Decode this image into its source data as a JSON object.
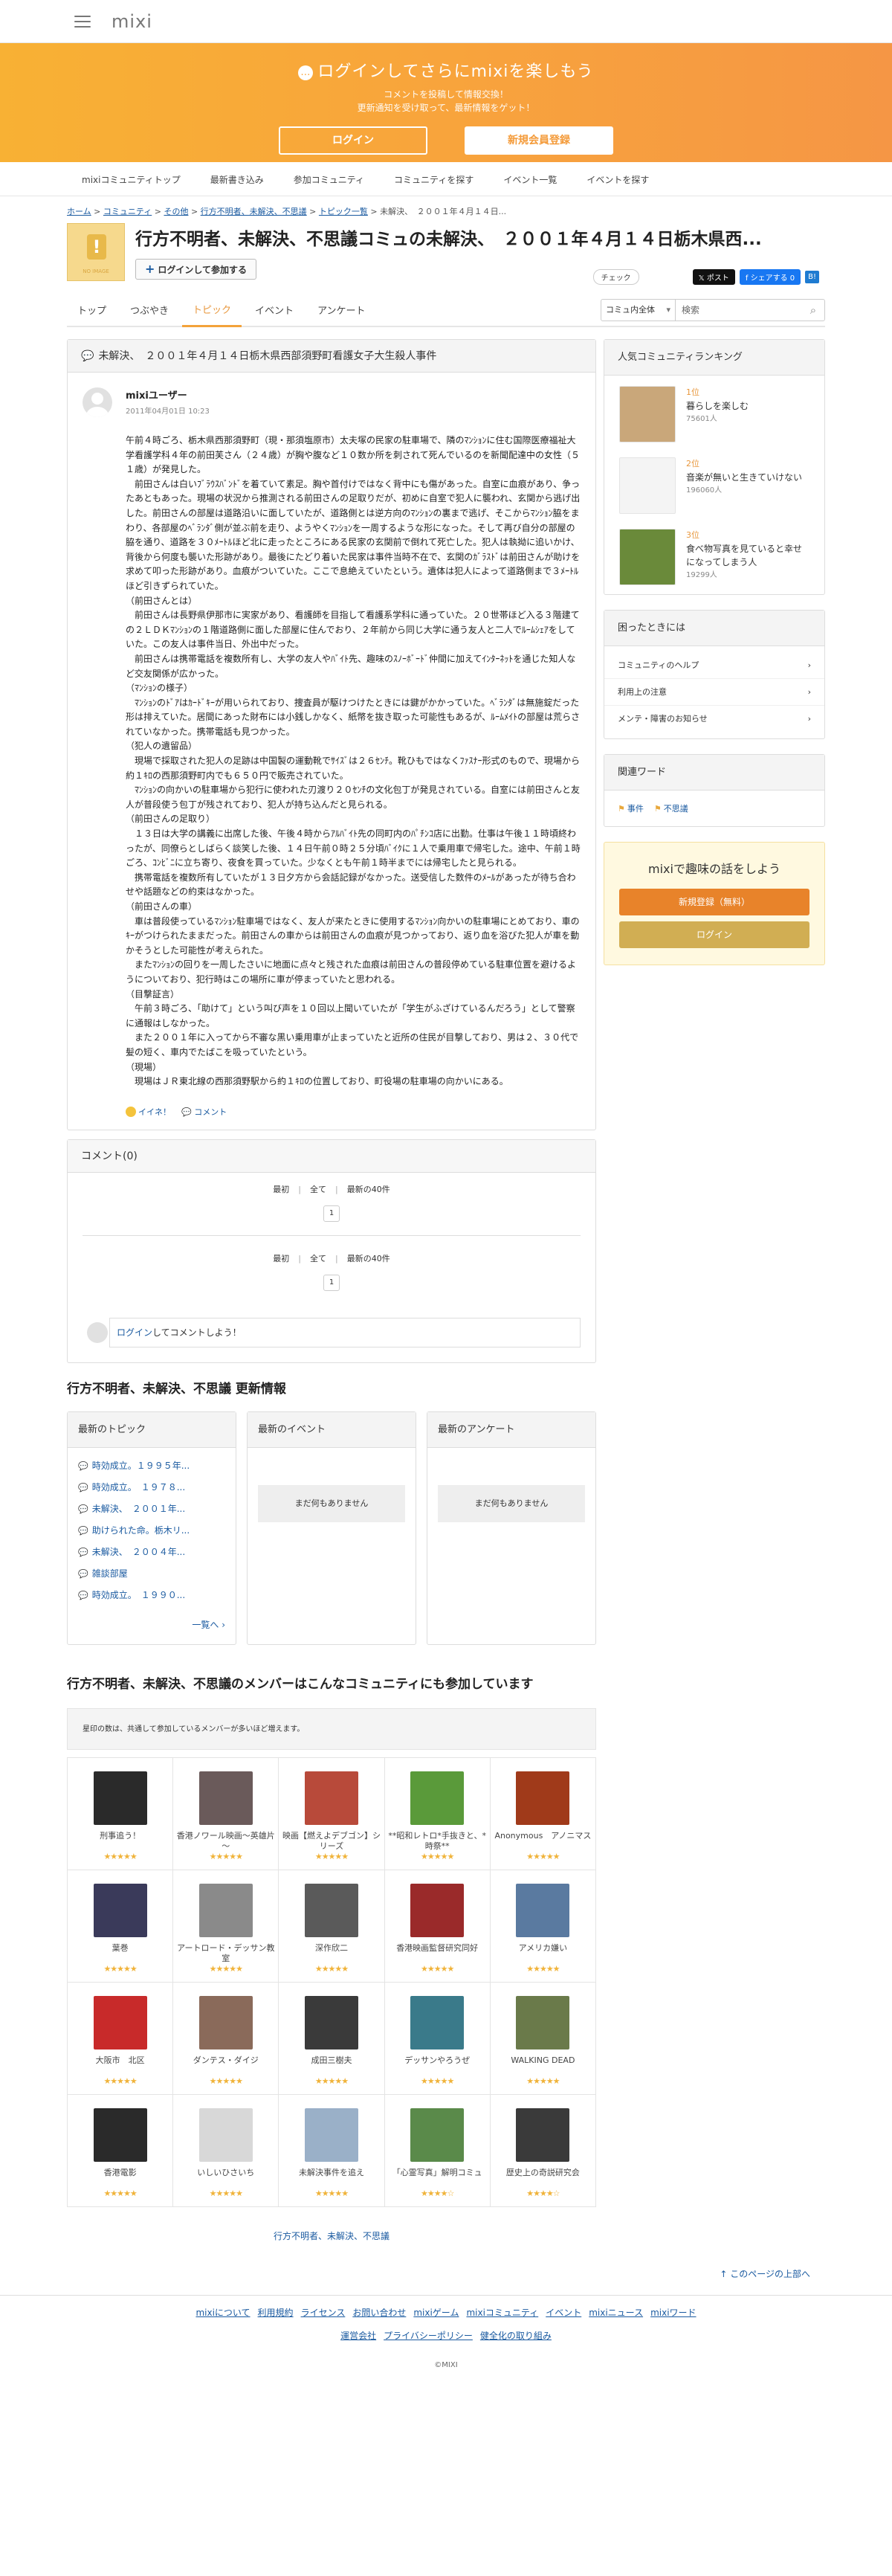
{
  "header": {
    "logo": "mixi"
  },
  "banner": {
    "title": "ログインしてさらにmixiを楽しもう",
    "sub1": "コメントを投稿して情報交換！",
    "sub2": "更新通知を受け取って、最新情報をゲット！",
    "login_label": "ログイン",
    "register_label": "新規会員登録"
  },
  "gnav": [
    "mixiコミュニティトップ",
    "最新書き込み",
    "参加コミュニティ",
    "コミュニティを探す",
    "イベント一覧",
    "イベントを探す"
  ],
  "breadcrumb": {
    "items": [
      "ホーム",
      "コミュニティ",
      "その他",
      "行方不明者、未解決、不思議",
      "トピック一覧"
    ],
    "current": "未解決、　２００１年４月１４日..."
  },
  "community": {
    "thumb_text": "NO IMAGE",
    "title": "行方不明者、未解決、不思議コミュの未解決、　２００１年４月１４日栃木県西...",
    "join_label": "ログインして参加する"
  },
  "share": {
    "check": "チェック",
    "post": "ポスト",
    "fb": "シェアする 0",
    "bm": "B!"
  },
  "tabs": [
    "トップ",
    "つぶやき",
    "トピック",
    "イベント",
    "アンケート"
  ],
  "search": {
    "scope": "コミュ内全体",
    "placeholder": "検索"
  },
  "topic": {
    "header": "未解決、　２００１年４月１４日栃木県西部須野町看護女子大生殺人事件",
    "user": "mixiユーザー",
    "date": "2011年04月01日 10:23",
    "body": "午前４時ごろ、栃木県西那須野町（現・那須塩原市）太夫塚の民家の駐車場で、隣のﾏﾝｼｮﾝに住む国際医療福祉大学看護学科４年の前田芙さん（２４歳）が胸や腹など１０数か所を刺されて死んでいるのを新聞配達中の女性（５１歳）が発見した。\n　前田さんは白いﾌﾞﾗｳｽﾊﾞﾝﾄﾞを着ていて素足。胸や首付けではなく背中にも傷があった。自室に血痕があり、争ったあともあった。現場の状況から推測される前田さんの足取りだが、初めに自室で犯人に襲われ、玄関から逃げ出した。前田さんの部屋は道路沿いに面していたが、道路側とは逆方向のﾏﾝｼｮﾝの裏まで逃げ、そこからﾏﾝｼｮﾝ脇をまわり、各部屋のﾍﾞﾗﾝﾀﾞ側が並ぶ前を走り、ようやくﾏﾝｼｮﾝを一周するような形になった。そして再び自分の部屋の脇を通り、道路を３０ﾒｰﾄﾙほど北に走ったところにある民家の玄関前で倒れて死亡した。犯人は執拗に追いかけ、背後から何度も襲いた形跡があり。最後にたどり着いた民家は事件当時不在で、玄関のｶﾞﾗｽﾄﾞは前田さんが助けを求めて叩った形跡があり。血痕がついていた。ここで息絶えていたという。遺体は犯人によって道路側まで３ﾒｰﾄﾙほど引きずられていた。\n（前田さんとは）\n　前田さんは長野県伊那市に実家があり、看護師を目指して看護系学科に通っていた。２０世帯ほど入る３階建ての２ＬＤＫﾏﾝｼｮﾝの１階道路側に面した部屋に住んでおり、２年前から同じ大学に通う友人と二人でﾙｰﾑｼｪｱをしていた。この友人は事件当日、外出中だった。\n　前田さんは携帯電話を複数所有し、大学の友人やﾊﾞｲﾄ先、趣味のｽﾉｰﾎﾞｰﾄﾞ仲間に加えてｲﾝﾀｰﾈｯﾄを通じた知人など交友関係が広かった。\n（ﾏﾝｼｮﾝの様子）\n　ﾏﾝｼｮﾝのﾄﾞｱはｶｰﾄﾞｷｰが用いられており、捜査員が駆けつけたときには鍵がかかっていた。ﾍﾞﾗﾝﾀﾞは無施錠だった形は排えていた。居間にあった財布には小銭しかなく、紙幣を抜き取った可能性もあるが、ﾙｰﾑﾒｲﾄの部屋は荒らされていなかった。携帯電話も見つかった。\n（犯人の遺留品）\n　現場で採取された犯人の足跡は中国製の運動靴でｻｲｽﾞは２６ｾﾝﾁ。靴ひもではなくﾌｧｽﾅｰ形式のもので、現場から約１ｷﾛの西那須野町内でも６５０円で販売されていた。\n　ﾏﾝｼｮﾝの向かいの駐車場から犯行に使われた刃渡り２０ｾﾝﾁの文化包丁が発見されている。自室には前田さんと友人が普段使う包丁が残されており、犯人が持ち込んだと見られる。\n（前田さんの足取り）\n　１３日は大学の講義に出席した後、午後４時からｱﾙﾊﾞｲﾄ先の同町内のﾊﾟﾁﾝｺ店に出勤。仕事は午後１１時頃終わったが、同僚らとしばらく談笑した後、１４日午前０時２５分頃ﾊﾞｲｸに１人で乗用車で帰宅した。途中、午前１時ごろ、ｺﾝﾋﾞﾆに立ち寄り、夜食を買っていた。少なくとも午前１時半までには帰宅したと見られる。\n　携帯電話を複数所有していたが１３日夕方から会話記録がなかった。送受信した数件のﾒｰﾙがあったが待ち合わせや話題などの約束はなかった。\n（前田さんの車）\n　車は普段使っているﾏﾝｼｮﾝ駐車場ではなく、友人が来たときに使用するﾏﾝｼｮﾝ向かいの駐車場にとめており、車のｷｰがつけられたままだった。前田さんの車からは前田さんの血痕が見つかっており、返り血を浴びた犯人が車を動かそうとした可能性が考えられた。\n　またﾏﾝｼｮﾝの回りを一周したさいに地面に点々と残された血痕は前田さんの普段停めている駐車位置を避けるようについており、犯行時はこの場所に車が停まっていたと思われる。\n（目撃証言）\n　午前３時ごろ、「助けて」という叫び声を１０回以上聞いていたが「学生がふざけているんだろう」として警察に通報はしなかった。\n　また２００１年に入ってから不審な黒い乗用車が止まっていたと近所の住民が目撃しており、男は２、３０代で髪の短く、車内でたばこを吸っていたという。\n（現場）\n　現場はＪＲ東北線の西那須野駅から約１ｷﾛの位置しており、町役場の駐車場の向かいにある。",
    "like": "イイネ！",
    "comment": "コメント"
  },
  "comments": {
    "header": "コメント(0)",
    "first": "最初",
    "all": "全て",
    "latest": "最新の40件",
    "page": "1",
    "prompt_link": "ログイン",
    "prompt_rest": "してコメントしよう！"
  },
  "updates": {
    "title": "行方不明者、未解決、不思議 更新情報",
    "topics_header": "最新のトピック",
    "events_header": "最新のイベント",
    "polls_header": "最新のアンケート",
    "topics": [
      "時効成立。１９９５年...",
      "時効成立。　１９７８...",
      "未解決、　２００１年...",
      "助けられた命。栃木リ...",
      "未解決、　２００４年...",
      "雑談部屋",
      "時効成立。　１９９０..."
    ],
    "more": "一覧へ",
    "empty": "まだ何もありません"
  },
  "members": {
    "title": "行方不明者、未解決、不思議のメンバーはこんなコミュニティにも参加しています",
    "note": "星印の数は、共通して参加しているメンバーが多いほど増えます。",
    "items": [
      {
        "name": "刑事追う！",
        "stars": "★★★★★",
        "color": "#2a2a2a"
      },
      {
        "name": "香港ノワール映画～英雄片～",
        "stars": "★★★★★",
        "color": "#6a5a5a"
      },
      {
        "name": "映画【燃えよデブゴン】シリーズ",
        "stars": "★★★★★",
        "color": "#b84a3a"
      },
      {
        "name": "**昭和レトロ*手抜きと、*時祭**",
        "stars": "★★★★★",
        "color": "#5a9a3a"
      },
      {
        "name": "Anonymous　アノニマス",
        "stars": "★★★★★",
        "color": "#a03a1a"
      },
      {
        "name": "葉巻",
        "stars": "★★★★★",
        "color": "#3a3a5a"
      },
      {
        "name": "アートロード・デッサン教室",
        "stars": "★★★★★",
        "color": "#8a8a8a"
      },
      {
        "name": "深作欣二",
        "stars": "★★★★★",
        "color": "#5a5a5a"
      },
      {
        "name": "香港映画監督研究同好",
        "stars": "★★★★★",
        "color": "#9a2a2a"
      },
      {
        "name": "アメリカ嫌い",
        "stars": "★★★★★",
        "color": "#5a7aa0"
      },
      {
        "name": "大阪市　北区",
        "stars": "★★★★★",
        "color": "#c82a2a"
      },
      {
        "name": "ダンテス・ダイジ",
        "stars": "★★★★★",
        "color": "#8a6a5a"
      },
      {
        "name": "成田三樹夫",
        "stars": "★★★★★",
        "color": "#3a3a3a"
      },
      {
        "name": "デッサンやろうぜ",
        "stars": "★★★★★",
        "color": "#3a7a8a"
      },
      {
        "name": "WALKING DEAD",
        "stars": "★★★★★",
        "color": "#6a7a4a"
      },
      {
        "name": "香港電影",
        "stars": "★★★★★",
        "color": "#2a2a2a"
      },
      {
        "name": "いしいひさいち",
        "stars": "★★★★★",
        "color": "#d8d8d8"
      },
      {
        "name": "未解決事件を追え",
        "stars": "★★★★★",
        "color": "#9ab0c8"
      },
      {
        "name": "「心霊写真」解明コミュ",
        "stars": "★★★★☆",
        "color": "#5a8a4a"
      },
      {
        "name": "歴史上の奇説研究会",
        "stars": "★★★★☆",
        "color": "#3a3a3a"
      }
    ]
  },
  "right": {
    "ranking_header": "人気コミュニティランキング",
    "ranking": [
      {
        "pos": "1位",
        "name": "暮らしを楽しむ",
        "count": "75601人",
        "color": "#c9a77a"
      },
      {
        "pos": "2位",
        "name": "音楽が無いと生きていけない",
        "count": "196060人",
        "color": "#f4f4f4"
      },
      {
        "pos": "3位",
        "name": "食べ物写真を見ていると幸せになってしまう人",
        "count": "19299人",
        "color": "#6a8a3a"
      }
    ],
    "help_header": "困ったときには",
    "help": [
      "コミュニティのヘルプ",
      "利用上の注意",
      "メンテ・障害のお知らせ"
    ],
    "kw_header": "関連ワード",
    "keywords": [
      "事件",
      "不思議"
    ],
    "promo_title": "mixiで趣味の話をしよう",
    "promo_reg": "新規登録（無料）",
    "promo_login": "ログイン"
  },
  "footer": {
    "comm_link": "行方不明者、未解決、不思議",
    "pagetop": "このページの上部へ",
    "links1": [
      "mixiについて",
      "利用規約",
      "ライセンス",
      "お問い合わせ",
      "mixiゲーム",
      "mixiコミュニティ",
      "イベント",
      "mixiニュース",
      "mixiワード"
    ],
    "links2": [
      "運営会社",
      "プライバシーポリシー",
      "健全化の取り組み"
    ],
    "copy": "©MIXI"
  }
}
